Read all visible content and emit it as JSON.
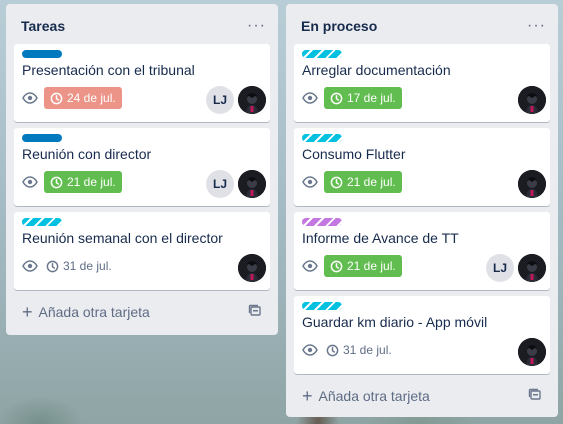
{
  "lists": [
    {
      "title": "Tareas",
      "menu": "···",
      "add_card": "Añada otra tarjeta",
      "cards": [
        {
          "title": "Presentación con el tribunal",
          "label": "blue",
          "due": "24 de jul.",
          "due_state": "overdue",
          "members": [
            "LJ",
            "photo"
          ]
        },
        {
          "title": "Reunión con director",
          "label": "blue",
          "due": "21 de jul.",
          "due_state": "complete",
          "members": [
            "LJ",
            "photo"
          ]
        },
        {
          "title": "Reunión semanal con el director",
          "label": "sky",
          "due": "31 de jul.",
          "due_state": "plain",
          "members": [
            "photo"
          ]
        }
      ]
    },
    {
      "title": "En proceso",
      "menu": "···",
      "add_card": "Añada otra tarjeta",
      "cards": [
        {
          "title": "Arreglar documentación",
          "label": "sky",
          "due": "17 de jul.",
          "due_state": "complete",
          "members": [
            "photo"
          ]
        },
        {
          "title": "Consumo Flutter",
          "label": "sky",
          "due": "21 de jul.",
          "due_state": "complete",
          "members": [
            "photo"
          ]
        },
        {
          "title": "Informe de Avance de TT",
          "label": "purple",
          "due": "21 de jul.",
          "due_state": "complete",
          "members": [
            "LJ",
            "photo"
          ]
        },
        {
          "title": "Guardar km diario - App móvil",
          "label": "sky",
          "due": "31 de jul.",
          "due_state": "plain",
          "members": [
            "photo"
          ]
        }
      ]
    }
  ],
  "colors": {
    "list_bg": "#ebecf0",
    "label_blue": "#0079bf",
    "label_sky": "#00c2e0",
    "label_purple": "#c377e0",
    "due_overdue": "#ec9488",
    "due_complete": "#61bd4f"
  },
  "icons": {
    "watch": "eye-icon",
    "due": "clock-icon",
    "add": "plus-icon",
    "template": "card-template-icon",
    "menu": "more-horizontal-icon"
  }
}
